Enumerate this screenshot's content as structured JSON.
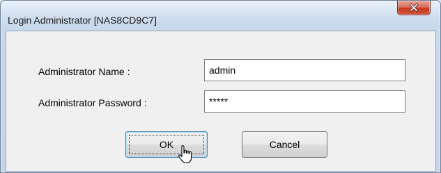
{
  "window": {
    "title": "Login Administrator [NAS8CD9C7]",
    "close_icon": "close-icon"
  },
  "form": {
    "name_label": "Administrator Name :",
    "name_value": "admin",
    "password_label": "Administrator Password :",
    "password_value": "*****"
  },
  "buttons": {
    "ok_label": "OK",
    "cancel_label": "Cancel"
  },
  "cursor_icon": "hand-pointer-icon"
}
